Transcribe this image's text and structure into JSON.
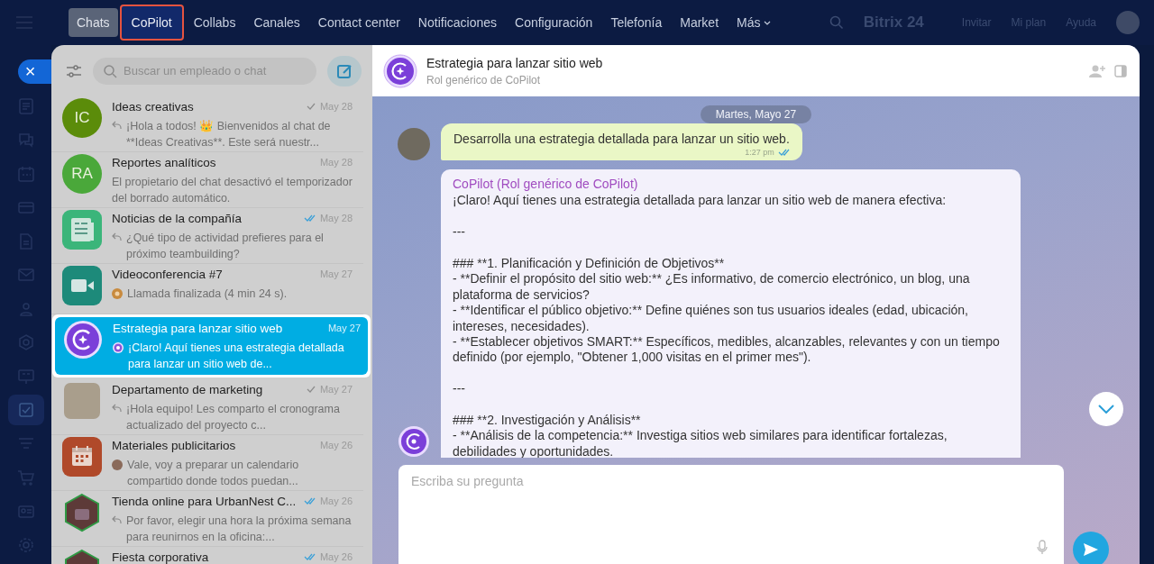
{
  "topbar": {
    "nav": [
      {
        "label": "Chats",
        "selected": true,
        "annotated": false
      },
      {
        "label": "CoPilot",
        "selected": false,
        "annotated": true
      },
      {
        "label": "Collabs",
        "selected": false,
        "annotated": false
      },
      {
        "label": "Canales",
        "selected": false,
        "annotated": false
      },
      {
        "label": "Contact center",
        "selected": false,
        "annotated": false
      },
      {
        "label": "Notificaciones",
        "selected": false,
        "annotated": false
      },
      {
        "label": "Configuración",
        "selected": false,
        "annotated": false
      },
      {
        "label": "Telefonía",
        "selected": false,
        "annotated": false
      },
      {
        "label": "Market",
        "selected": false,
        "annotated": false
      },
      {
        "label": "Más",
        "selected": false,
        "annotated": false,
        "kind": "dropdown"
      }
    ],
    "brand": "Bitrix 24",
    "links": [
      "Invitar",
      "Mi plan",
      "Ayuda"
    ]
  },
  "rail": {
    "close_label": "×",
    "items": [
      {
        "kind": "feed",
        "selected": false
      },
      {
        "kind": "chat",
        "selected": false
      },
      {
        "kind": "calendar",
        "selected": false
      },
      {
        "kind": "card",
        "selected": false
      },
      {
        "kind": "document",
        "selected": false
      },
      {
        "kind": "mail",
        "selected": false
      },
      {
        "kind": "people",
        "selected": false
      },
      {
        "kind": "hexagon",
        "selected": false
      },
      {
        "kind": "board",
        "selected": false
      },
      {
        "kind": "tasks",
        "selected": true
      },
      {
        "kind": "funnel",
        "selected": false
      },
      {
        "kind": "cart",
        "selected": false
      },
      {
        "kind": "contact",
        "selected": false
      },
      {
        "kind": "settings",
        "selected": false
      }
    ]
  },
  "chat_list": {
    "search": {
      "placeholder": "Buscar un empleado o chat"
    },
    "chats": [
      {
        "title": "Ideas creativas",
        "date": "May 28",
        "receipt": {
          "kind": "sent"
        },
        "preview_icon": {
          "kind": "reply"
        },
        "preview": "¡Hola a todos! 👑 Bienvenidos al chat de **Ideas Creativas**. Este será nuestr...",
        "avatar": {
          "kind": "initials",
          "initials": "IC",
          "color": "#5b8c0a"
        },
        "selected": false
      },
      {
        "title": "Reportes analíticos",
        "date": "May 28",
        "preview": "El propietario del chat desactivó el temporizador del borrado automático.",
        "avatar": {
          "kind": "initials",
          "initials": "RA",
          "color": "#4aa83a"
        },
        "selected": false
      },
      {
        "title": "Noticias de la compañía",
        "date": "May 28",
        "receipt": {
          "kind": "read"
        },
        "preview_icon": {
          "kind": "reply"
        },
        "preview": "¿Qué tipo de actividad prefieres para el próximo teambuilding?",
        "avatar": {
          "kind": "news"
        },
        "selected": false
      },
      {
        "title": "Videoconferencia #7",
        "date": "May 27",
        "preview_icon": {
          "kind": "call"
        },
        "preview": "Llamada finalizada (4 min 24 s).",
        "avatar": {
          "kind": "video"
        },
        "selected": false
      },
      {
        "title": "Estrategia para lanzar sitio web",
        "date": "May 27",
        "preview_icon": {
          "kind": "copilot"
        },
        "preview": "¡Claro! Aquí tienes una estrategia detallada para lanzar un sitio web de...",
        "avatar": {
          "kind": "copilot"
        },
        "selected": true
      },
      {
        "title": "Departamento de marketing",
        "date": "May 27",
        "receipt": {
          "kind": "sent"
        },
        "preview_icon": {
          "kind": "reply"
        },
        "preview": "¡Hola equipo! Les comparto el cronograma actualizado del proyecto c...",
        "avatar": {
          "kind": "photo"
        },
        "selected": false
      },
      {
        "title": "Materiales publicitarios",
        "date": "May 26",
        "preview_icon": {
          "kind": "person"
        },
        "preview": "Vale, voy a preparar un calendario compartido donde todos puedan...",
        "avatar": {
          "kind": "calendar"
        },
        "selected": false
      },
      {
        "title": "Tienda online para UrbanNest C...",
        "date": "May 26",
        "receipt": {
          "kind": "read"
        },
        "preview_icon": {
          "kind": "reply"
        },
        "preview": "Por favor, elegir una hora la próxima semana para reunirnos en la oficina:...",
        "avatar": {
          "kind": "hexagon"
        },
        "selected": false
      },
      {
        "title": "Fiesta corporativa",
        "date": "May 26",
        "receipt": {
          "kind": "read"
        },
        "avatar": {
          "kind": "hexagon"
        },
        "selected": false
      }
    ]
  },
  "chat": {
    "title": "Estrategia para lanzar sitio web",
    "subtitle": "Rol genérico de CoPilot",
    "date_separator": "Martes, Mayo 27",
    "messages": [
      {
        "kind": "outgoing",
        "text": "Desarrolla una estrategia detallada para lanzar un sitio web.",
        "time": "1:27 pm",
        "receipt": {
          "kind": "read"
        }
      },
      {
        "kind": "incoming",
        "author": "CoPilot (Rol genérico de CoPilot)",
        "paragraphs": [
          "¡Claro! Aquí tienes una estrategia detallada para lanzar un sitio web de manera efectiva:",
          "---",
          "### **1. Planificación y Definición de Objetivos**\n- **Definir el propósito del sitio web:** ¿Es informativo, de comercio electrónico, un blog, una plataforma de servicios?\n- **Identificar el público objetivo:** Define quiénes son tus usuarios ideales (edad, ubicación, intereses, necesidades).\n- **Establecer objetivos SMART:** Específicos, medibles, alcanzables, relevantes y con un tiempo definido (por ejemplo, \"Obtener 1,000 visitas en el primer mes\").",
          "---",
          "### **2. Investigación y Análisis**\n- **Análisis de la competencia:** Investiga sitios web similares para identificar fortalezas, debilidades y oportunidades."
        ]
      }
    ],
    "composer": {
      "placeholder": "Escriba su pregunta"
    }
  }
}
